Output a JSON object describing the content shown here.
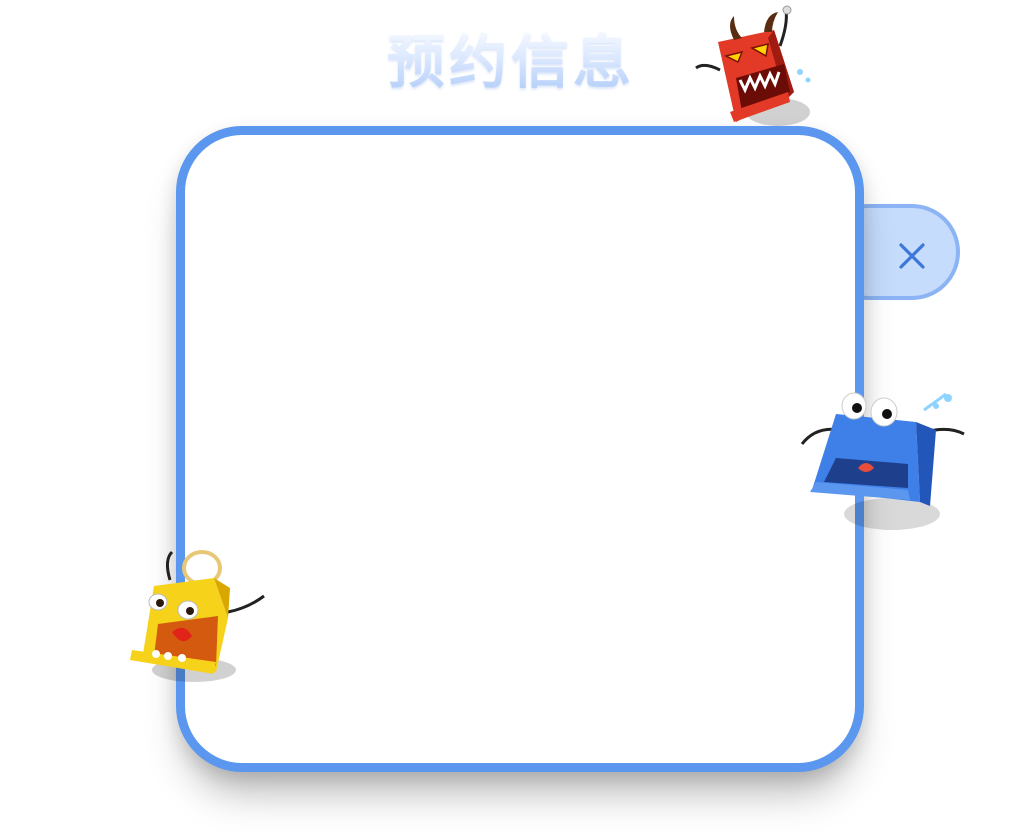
{
  "dialog": {
    "title": "预约信息",
    "close_icon": "close-icon",
    "content": ""
  },
  "mascots": [
    {
      "icon": "red-devil-mascot-icon"
    },
    {
      "icon": "blue-crying-mascot-icon"
    },
    {
      "icon": "yellow-angel-mascot-icon"
    }
  ],
  "colors": {
    "panel_border": "#5b97ef",
    "close_tab_fill": "#c5dcfc",
    "close_tab_border": "#8cb4f5",
    "close_icon": "#3c78d8",
    "title_gradient_bottom": "#a8c6f7"
  }
}
